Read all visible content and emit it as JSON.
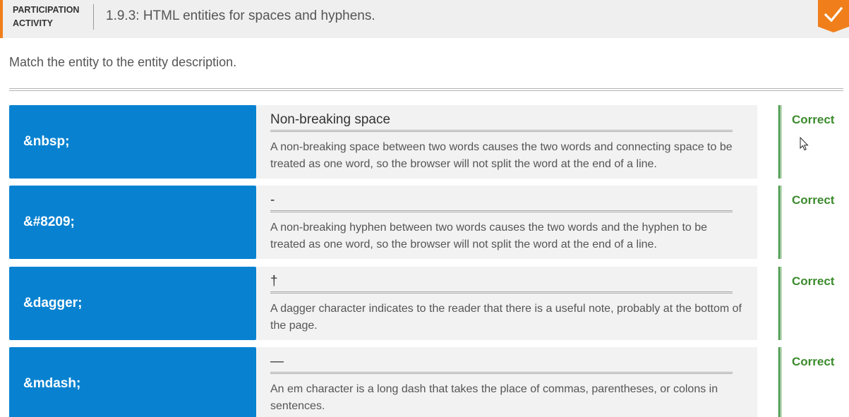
{
  "header": {
    "label": "PARTICIPATION ACTIVITY",
    "title": "1.9.3: HTML entities for spaces and hyphens.",
    "done_icon": "checkmark-icon"
  },
  "instructions": "Match the entity to the entity description.",
  "rows": [
    {
      "term": "&nbsp;",
      "answer": "Non-breaking space",
      "description": "A non-breaking space between two words causes the two words and connecting space to be treated as one word, so the browser will not split the word at the end of a line.",
      "status": "Correct"
    },
    {
      "term": "&#8209;",
      "answer": "‑",
      "description": "A non-breaking hyphen between two words causes the two words and the hyphen to be treated as one word, so the browser will not split the word at the end of a line.",
      "status": "Correct"
    },
    {
      "term": "&dagger;",
      "answer": "†",
      "description": "A dagger character indicates to the reader that there is a useful note, probably at the bottom of the page.",
      "status": "Correct"
    },
    {
      "term": "&mdash;",
      "answer": "—",
      "description": "An em character is a long dash that takes the place of commas, parentheses, or colons in sentences.",
      "status": "Correct"
    }
  ],
  "colors": {
    "accent": "#f07f1b",
    "term_bg": "#0882d0",
    "correct": "#3b8a2c"
  }
}
